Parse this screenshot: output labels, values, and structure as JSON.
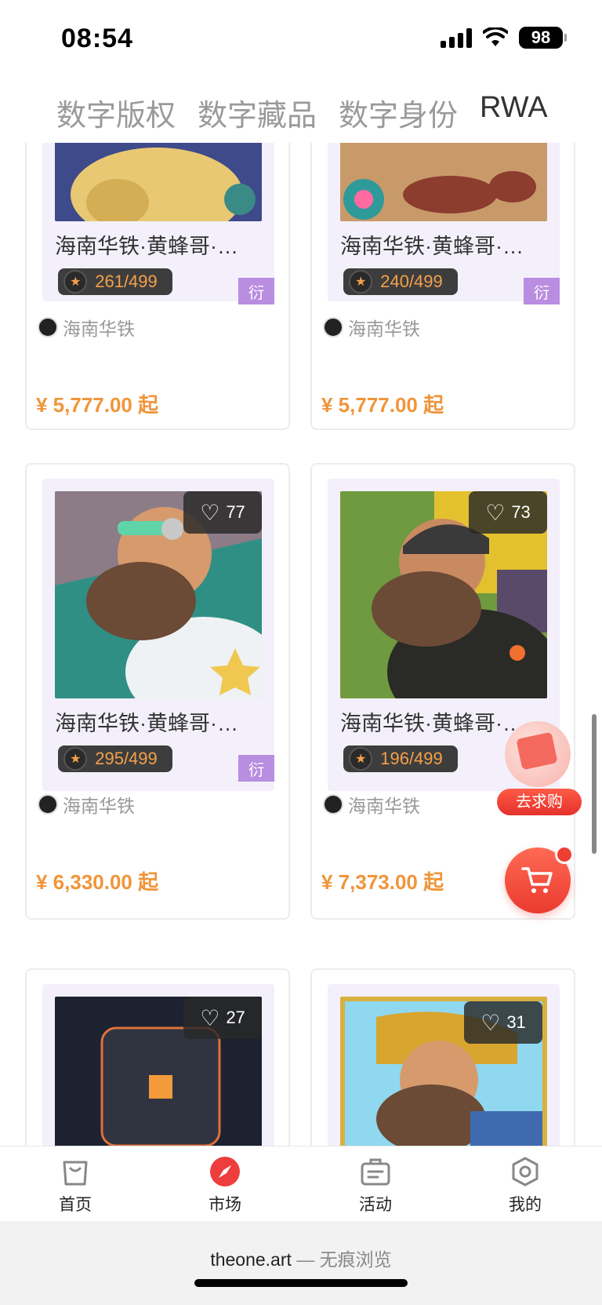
{
  "status_bar": {
    "time": "08:54",
    "battery": "98"
  },
  "tabs": [
    {
      "label": "数字版权",
      "active": false
    },
    {
      "label": "数字藏品",
      "active": false
    },
    {
      "label": "数字身份",
      "active": false
    },
    {
      "label": "RWA",
      "active": true
    }
  ],
  "cards": [
    {
      "title": "海南华铁·黄蜂哥·…",
      "edition": "261/499",
      "derive_tag": "衍",
      "creator": "海南华铁",
      "price": "¥ 5,777.00 起",
      "likes": ""
    },
    {
      "title": "海南华铁·黄蜂哥·…",
      "edition": "240/499",
      "derive_tag": "衍",
      "creator": "海南华铁",
      "price": "¥ 5,777.00 起",
      "likes": ""
    },
    {
      "title": "海南华铁·黄蜂哥·…",
      "edition": "295/499",
      "derive_tag": "衍",
      "creator": "海南华铁",
      "price": "¥ 6,330.00 起",
      "likes": "77"
    },
    {
      "title": "海南华铁·黄蜂哥·…",
      "edition": "196/499",
      "derive_tag": "",
      "creator": "海南华铁",
      "price": "¥ 7,373.00 起",
      "likes": "73"
    },
    {
      "likes": "27"
    },
    {
      "likes": "31"
    }
  ],
  "floating": {
    "beg_label": "去求购"
  },
  "bottom_nav": [
    {
      "label": "首页",
      "icon": "bag-icon"
    },
    {
      "label": "市场",
      "icon": "compass-icon",
      "active": true
    },
    {
      "label": "活动",
      "icon": "briefcase-icon"
    },
    {
      "label": "我的",
      "icon": "hexagon-icon"
    }
  ],
  "browser": {
    "domain": "theone.art",
    "mode": " — 无痕浏览"
  },
  "colors": {
    "price": "#f0953a",
    "accent_red": "#ea3a2f",
    "derive_tag": "#b98de0",
    "tab_active": "#333333",
    "tab_inactive": "#9a9a9a"
  }
}
